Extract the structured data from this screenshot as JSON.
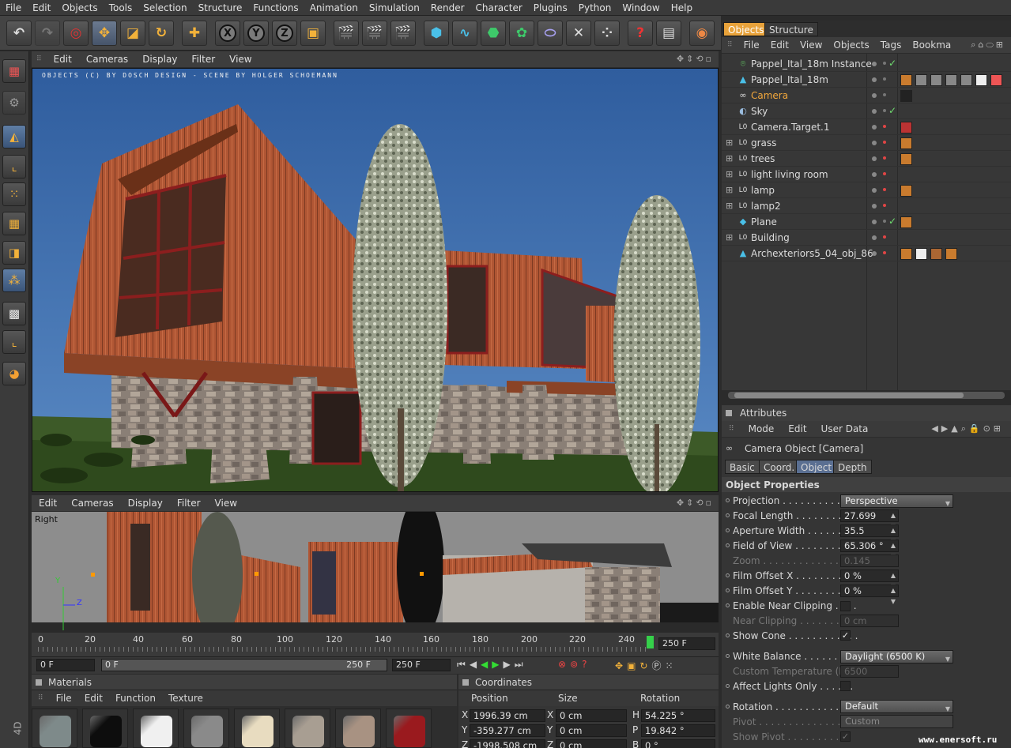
{
  "menu": [
    "File",
    "Edit",
    "Objects",
    "Tools",
    "Selection",
    "Structure",
    "Functions",
    "Animation",
    "Simulation",
    "Render",
    "Character",
    "Plugins",
    "Python",
    "Window",
    "Help"
  ],
  "toolbar": {
    "axis_x": "X",
    "axis_y": "Y",
    "axis_z": "Z"
  },
  "viewport": {
    "menu": [
      "Edit",
      "Cameras",
      "Display",
      "Filter",
      "View"
    ],
    "credit": "OBJECTS (C) BY DOSCH DESIGN - SCENE BY HOLGER SCHOEMANN",
    "secondary_menu": [
      "Edit",
      "Cameras",
      "Display",
      "Filter",
      "View"
    ],
    "secondary_label": "Right",
    "axis_y": "Y",
    "axis_z": "Z"
  },
  "timeline": {
    "ticks": [
      "0",
      "20",
      "40",
      "60",
      "80",
      "100",
      "120",
      "140",
      "160",
      "180",
      "200",
      "220",
      "240"
    ],
    "end_frame": "250 F",
    "current_frame": "0 F",
    "range_start": "0 F",
    "range_end": "250 F",
    "max_frame": "250 F"
  },
  "materials": {
    "title": "Materials",
    "menu": [
      "File",
      "Edit",
      "Function",
      "Texture"
    ],
    "swatches": [
      "#7e8a8a",
      "#0d0d0d",
      "#f0f0f0",
      "#8a8a8a",
      "#e8dcc0",
      "#a89e92",
      "#a89282",
      "#9a1a1e"
    ]
  },
  "coordinates": {
    "title": "Coordinates",
    "headers": [
      "Position",
      "Size",
      "Rotation"
    ],
    "rows": [
      {
        "axis": "X",
        "pos": "1996.39 cm",
        "size_axis": "X",
        "size": "0 cm",
        "rot_axis": "H",
        "rot": "54.225 °"
      },
      {
        "axis": "Y",
        "pos": "-359.277 cm",
        "size_axis": "Y",
        "size": "0 cm",
        "rot_axis": "P",
        "rot": "19.842 °"
      },
      {
        "axis": "Z",
        "pos": "-1998.508 cm",
        "size_axis": "Z",
        "size": "0 cm",
        "rot_axis": "B",
        "rot": "0 °"
      }
    ]
  },
  "objects": {
    "tabs": [
      "Objects",
      "Structure"
    ],
    "menu": [
      "File",
      "Edit",
      "View",
      "Objects",
      "Tags",
      "Bookma"
    ],
    "items": [
      {
        "name": "Pappel_Ital_18m Instance",
        "icon": "instance-icon",
        "check": "✓",
        "highlight": false
      },
      {
        "name": "Pappel_Ital_18m",
        "icon": "polygon-icon",
        "check": "",
        "highlight": false
      },
      {
        "name": "Camera",
        "icon": "camera-icon",
        "check": "",
        "highlight": true
      },
      {
        "name": "Sky",
        "icon": "sky-icon",
        "check": "✓",
        "highlight": false
      },
      {
        "name": "Camera.Target.1",
        "icon": "null-icon",
        "check": "",
        "highlight": false
      },
      {
        "name": "grass",
        "icon": "null-icon",
        "check": "",
        "highlight": false
      },
      {
        "name": "trees",
        "icon": "null-icon",
        "check": "",
        "highlight": false
      },
      {
        "name": "light living room",
        "icon": "null-icon",
        "check": "",
        "highlight": false
      },
      {
        "name": "lamp",
        "icon": "null-icon",
        "check": "",
        "highlight": false
      },
      {
        "name": "lamp2",
        "icon": "null-icon",
        "check": "",
        "highlight": false
      },
      {
        "name": "Plane",
        "icon": "plane-icon",
        "check": "✓",
        "highlight": false
      },
      {
        "name": "Building",
        "icon": "null-icon",
        "check": "",
        "highlight": false
      },
      {
        "name": "Archexteriors5_04_obj_86",
        "icon": "polygon-icon",
        "check": "",
        "highlight": false
      }
    ]
  },
  "attributes": {
    "title": "Attributes",
    "menu": [
      "Mode",
      "Edit",
      "User Data"
    ],
    "object_title": "Camera Object [Camera]",
    "tabs": [
      "Basic",
      "Coord.",
      "Object",
      "Depth"
    ],
    "section": "Object Properties",
    "projection_label": "Projection . . . . . . . . . . . .",
    "projection": "Perspective",
    "focal_label": "Focal Length . . . . . . . . . .",
    "focal": "27.699",
    "aperture_label": "Aperture Width . . . . . . . .",
    "aperture": "35.5",
    "fov_label": "Field of View . . . . . . . . . .",
    "fov": "65.306 °",
    "zoom_label": "Zoom . . . . . . . . . . . . . . . .",
    "zoom": "0.145",
    "offx_label": "Film Offset X . . . . . . . . . .",
    "offx": "0 %",
    "offy_label": "Film Offset Y . . . . . . . . . .",
    "offy": "0 %",
    "near_label": "Enable Near Clipping . . . .",
    "nearclip_label": "Near Clipping . . . . . . . . .",
    "nearclip": "0 cm",
    "cone_label": "Show Cone . . . . . . . . . . . .",
    "cone": "✓",
    "wb_label": "White Balance . . . . . . . . .",
    "wb": "Daylight (6500 K)",
    "temp_label": "Custom Temperature (K)",
    "temp": "6500",
    "affect_label": "Affect Lights Only . . . . . .",
    "rotation_label": "Rotation . . . . . . . . . . . . . .",
    "rotation": "Default",
    "pivot_label": "Pivot . . . . . . . . . . . . . . . .",
    "pivot": "Custom",
    "showpivot_label": "Show Pivot . . . . . . . . . . .",
    "showpivot": "✓"
  },
  "watermark": "www.enersoft.ru",
  "side_label": "4D",
  "colors": {
    "accent": "#f2a73b",
    "selection_tab": "#e8a23a",
    "sky": "#3e6aa8",
    "wood": "#b45a36"
  }
}
